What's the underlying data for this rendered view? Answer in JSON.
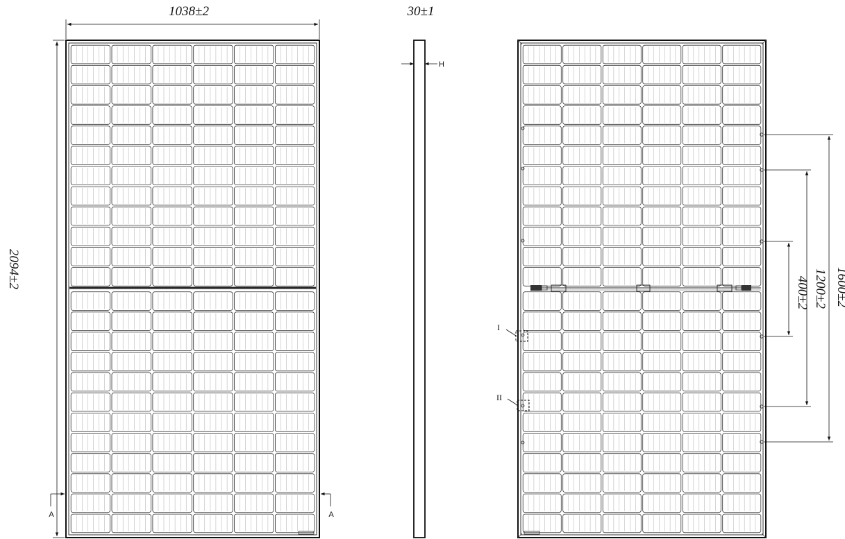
{
  "drawing": {
    "dimensions": {
      "width": "1038±2",
      "height": "2094±2",
      "thickness": "30±1",
      "hole_pitch_400": "400±2",
      "hole_pitch_1200": "1200±2",
      "hole_pitch_1600": "1600±2"
    },
    "labels": {
      "section_left": "A",
      "section_right": "A",
      "frame_height": "H",
      "detail_1": "I",
      "detail_2": "II"
    },
    "panel": {
      "cell_columns": 6,
      "cell_rows": 24,
      "line_color": "#333333"
    }
  }
}
